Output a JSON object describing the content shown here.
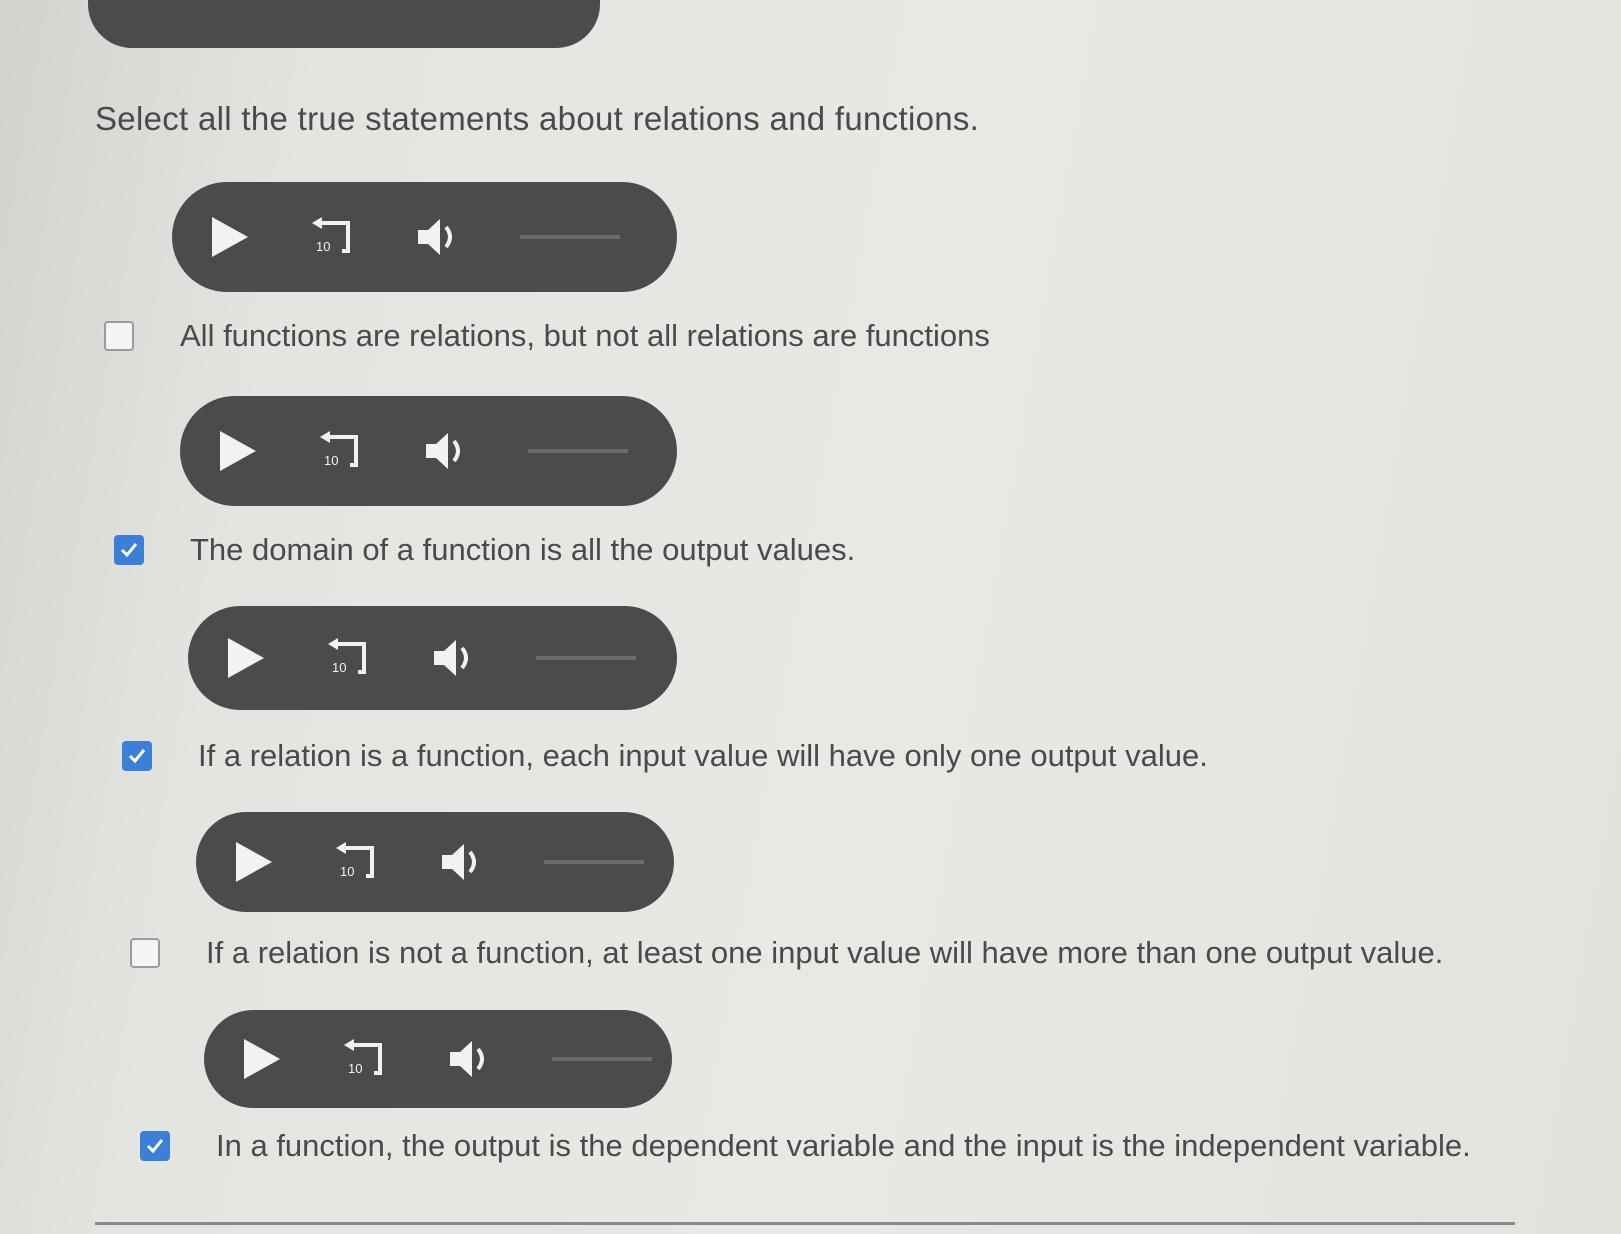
{
  "question": {
    "prompt": "Select all the true statements about relations and functions."
  },
  "player": {
    "rewind_label": "10",
    "controls": [
      "play-icon",
      "rewind-10-icon",
      "volume-icon",
      "progress-track"
    ]
  },
  "options": [
    {
      "text": "All functions are relations, but not all relations are functions",
      "checked": false
    },
    {
      "text": "The domain of a function is all the output values.",
      "checked": true
    },
    {
      "text": "If a relation is a function, each input value will have only one output value.",
      "checked": true
    },
    {
      "text": "If a relation is not a function, at least one input value will have more than one output value.",
      "checked": false
    },
    {
      "text": "In a function, the output is the dependent variable and the input is the independent variable.",
      "checked": true
    }
  ],
  "colors": {
    "player_bg": "#4b4b4d",
    "checkbox_checked": "#3b7fd6",
    "text": "#4a4a4a"
  }
}
